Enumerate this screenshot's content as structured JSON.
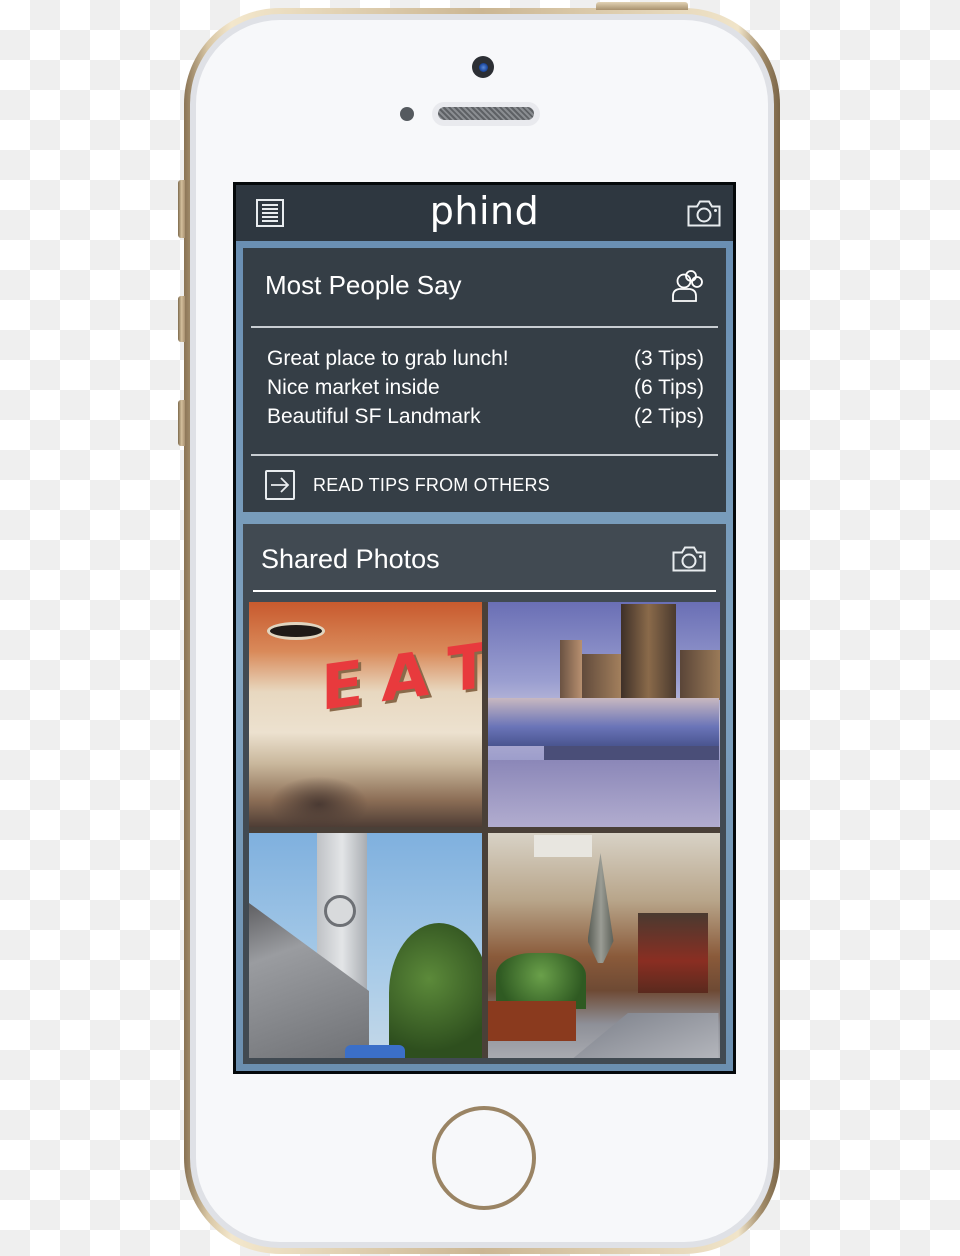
{
  "device": {
    "type": "smartphone",
    "frame_color": "#c9b28c"
  },
  "navbar": {
    "menu_icon": "menu-icon",
    "brand": "phind",
    "camera_icon": "camera-icon"
  },
  "most_people_say": {
    "title": "Most People Say",
    "icon": "people-group-icon",
    "tips": [
      {
        "text": "Great place to grab lunch!",
        "count": "(3 Tips)"
      },
      {
        "text": "Nice market inside",
        "count": "(6 Tips)"
      },
      {
        "text": "Beautiful SF Landmark",
        "count": "(2 Tips)"
      }
    ],
    "read_tips_icon": "arrow-right-box-icon",
    "read_tips_label": "READ TIPS FROM OTHERS"
  },
  "shared_photos": {
    "title": "Shared Photos",
    "icon": "camera-icon",
    "photos": [
      {
        "subject": "EAT sign in food market interior",
        "sign_text": "EAT"
      },
      {
        "subject": "Ferry Building waterfront skyline at dusk"
      },
      {
        "subject": "Ferry Building clock tower with flags"
      },
      {
        "subject": "Market stalls with plants and umbrellas"
      }
    ]
  },
  "colors": {
    "navbar_bg": "#2e3740",
    "card_bg": "#353e46",
    "accent_border": "#6f93b5",
    "text": "#ffffff"
  }
}
